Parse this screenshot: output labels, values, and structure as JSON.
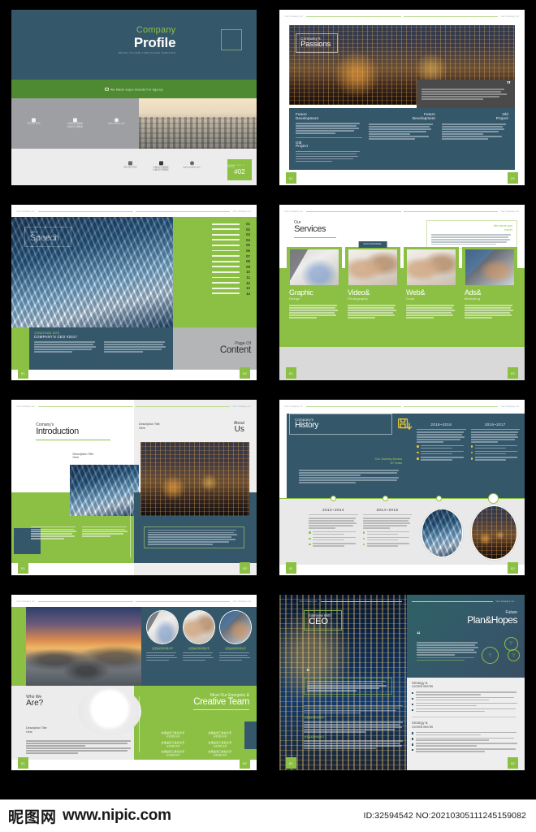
{
  "meta": {
    "header_label": "Your Company Inc.",
    "accent_green": "#8cc044",
    "band_green": "#4e8a32",
    "navy": "#35576a",
    "grey": "#ececec"
  },
  "footer": {
    "logo_cn": "昵图网",
    "logo_url": "www.nipic.com",
    "id_text": "ID:32594542 NO:20210305111245159082"
  },
  "spreads": [
    {
      "id": "cover",
      "title_top": "Company",
      "title_main": "Profile",
      "subtitle": "BRAND VOLUME 2 BROCHURE TEMPLATE",
      "tagline": "We Made Super Brands For Agency",
      "info": [
        {
          "icon": "phone-icon",
          "line1": "电话咨询",
          "line2": "400-000-0000"
        },
        {
          "icon": "location-icon",
          "line1": "地址",
          "line2": "中国北京市朝阳区",
          "line3": "邮编",
          "line4": "中国北京市朝阳区"
        },
        {
          "icon": "globe-icon",
          "line1": "公司网站地址",
          "line2": "www.yoursite.com"
        }
      ],
      "badge_label": "BRAND VOL 2 ISSUE",
      "badge_number": "#02",
      "page_left": "01",
      "page_right": "02"
    },
    {
      "id": "passions",
      "title_top": "Company's",
      "title_main": "Passions",
      "quote_mark": "”",
      "sections": [
        {
          "label": "Future\nDevelopment",
          "align": "left",
          "icon": ""
        },
        {
          "label": "Old\nProject",
          "align": "left",
          "icon": ""
        },
        {
          "label": "Future\nDevelopment",
          "align": "right",
          "icon": "pencil-icon"
        },
        {
          "label": "Old\nProject",
          "align": "right",
          "icon": "plus-circle-icon"
        }
      ],
      "page_left": "01",
      "page_right": "02"
    },
    {
      "id": "ceo-speech",
      "title_top": "CEO",
      "title_main": "Speech",
      "author_name": "JONATHAN DOE",
      "author_role": "COMPANY'S CEO  #2017",
      "content_top": "Page Of",
      "content_main": "Content",
      "toc_numbers": [
        "01",
        "02",
        "03",
        "04",
        "05",
        "06",
        "07",
        "08",
        "09",
        "10",
        "11",
        "12",
        "13",
        "14"
      ],
      "page_left": "01",
      "page_right": "02"
    },
    {
      "id": "services",
      "title_top": "Our",
      "title_main": "Services",
      "note_title": "We serve you\nmore!",
      "ribbon": "RECOMENDED!",
      "cards": [
        {
          "title": "Graphic",
          "subtitle": "Design",
          "image": "laptop-desk-photo"
        },
        {
          "title": "Video&",
          "subtitle": "Photography",
          "image": "laptop-hands-photo"
        },
        {
          "title": "Web&",
          "subtitle": "Cods",
          "image": "writing-hands-photo"
        },
        {
          "title": "Ads&",
          "subtitle": "Marketing",
          "image": "tablet-hands-photo"
        }
      ],
      "page_left": "01",
      "page_right": "02"
    },
    {
      "id": "introduction",
      "title_top": "Comany's",
      "title_main": "Introduction",
      "caption_left": "Description Title\nHere",
      "about_top": "About",
      "about_main": "Us",
      "caption_right": "Description Title\nHere",
      "page_left": "01",
      "page_right": "02"
    },
    {
      "id": "history",
      "title_top": "Company's",
      "title_main": "History",
      "journey_label": "Our Journey Across\n10 Years",
      "icon": "save-disk-download-icon",
      "years_top": [
        "2015~2016",
        "2016~2017"
      ],
      "years_bottom": [
        "2013~2014",
        "2014~2015"
      ],
      "page_left": "01",
      "page_right": "02"
    },
    {
      "id": "team",
      "title_top": "Who We",
      "title_main": "Are?",
      "caption": "Description Title\nHere",
      "team_top": "Meet Our Energetic &",
      "team_main": "Creative Team",
      "features": [
        {
          "title": "这里是标题内容文字",
          "sub": "这里是标题内容文字"
        },
        {
          "title": "这里是标题内容文字",
          "sub": "这里是标题内容文字"
        },
        {
          "title": "这里是标题内容文字",
          "sub": "这里是标题内容文字"
        }
      ],
      "members": [
        {
          "name": "这里是员工姓名文字",
          "role": "这里是职位名称"
        },
        {
          "name": "这里是员工姓名文字",
          "role": "这里是职位名称"
        },
        {
          "name": "这里是员工姓名文字",
          "role": "这里是职位名称"
        },
        {
          "name": "这里是员工姓名文字",
          "role": "这里是职位名称"
        },
        {
          "name": "这里是员工姓名文字",
          "role": "这里是职位名称"
        },
        {
          "name": "这里是员工姓名文字",
          "role": "这里是职位名称"
        }
      ],
      "page_left": "01",
      "page_right": "02"
    },
    {
      "id": "ceo-interview",
      "title_top": "Interview With",
      "title_main": "CEO",
      "plan_top": "Future",
      "plan_main": "Plan&Hopes",
      "strategy_title_1": "Strategy &\ncomminments",
      "strategy_title_2": "Strategy &\ncomminments",
      "page_left": "01",
      "page_right": "02"
    }
  ]
}
